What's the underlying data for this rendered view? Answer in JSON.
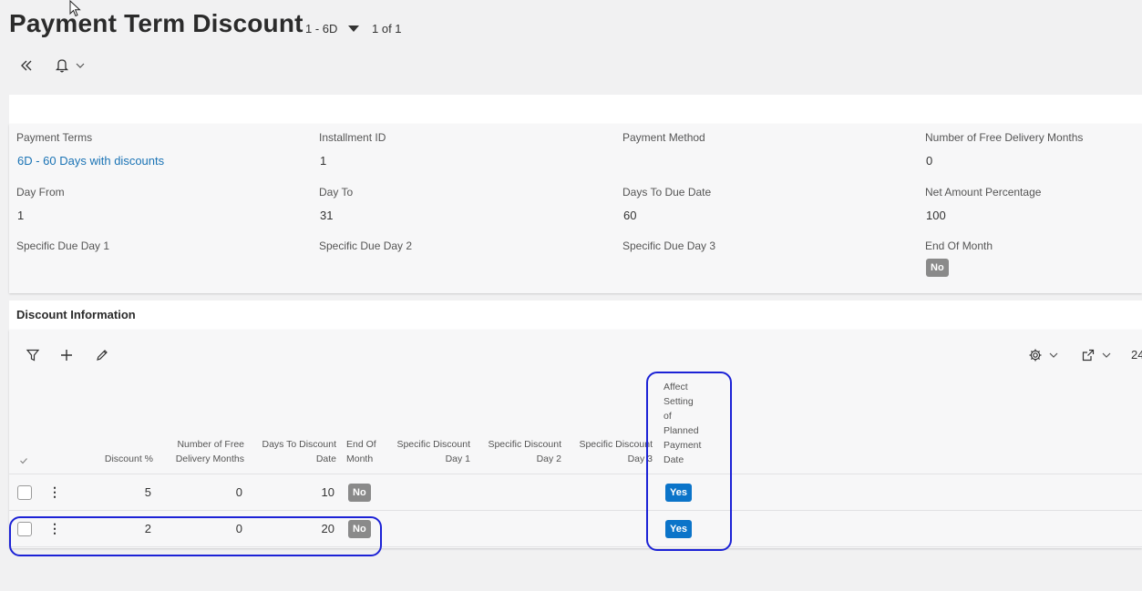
{
  "page": {
    "title": "Payment Term Discount",
    "record_selector": "1 - 6D",
    "record_count": "1 of 1"
  },
  "toolbar_icons": [
    "double-chevron-left-icon",
    "bell-icon",
    "chevron-down-icon"
  ],
  "fields": {
    "payment_terms": {
      "label": "Payment Terms",
      "value": "6D - 60 Days with discounts"
    },
    "installment_id": {
      "label": "Installment ID",
      "value": "1"
    },
    "payment_method": {
      "label": "Payment Method",
      "value": ""
    },
    "free_delivery_months": {
      "label": "Number of Free Delivery Months",
      "value": "0"
    },
    "day_from": {
      "label": "Day From",
      "value": "1"
    },
    "day_to": {
      "label": "Day To",
      "value": "31"
    },
    "days_to_due_date": {
      "label": "Days To Due Date",
      "value": "60"
    },
    "net_amount_pct": {
      "label": "Net Amount Percentage",
      "value": "100"
    },
    "specific_due_day_1": {
      "label": "Specific Due Day 1",
      "value": ""
    },
    "specific_due_day_2": {
      "label": "Specific Due Day 2",
      "value": ""
    },
    "specific_due_day_3": {
      "label": "Specific Due Day 3",
      "value": ""
    },
    "end_of_month": {
      "label": "End Of Month",
      "value": "No"
    }
  },
  "discount": {
    "title": "Discount Information",
    "page_size_partial": "24",
    "columns": {
      "discount_pct": "Discount %",
      "free_delivery_1": "Number of Free",
      "free_delivery_2": "Delivery Months",
      "days_to_discount_1": "Days To Discount",
      "days_to_discount_2": "Date",
      "end_of_month_1": "End Of",
      "end_of_month_2": "Month",
      "sdd1_1": "Specific Discount",
      "sdd1_2": "Day 1",
      "sdd2_1": "Specific Discount",
      "sdd2_2": "Day 2",
      "sdd3_1": "Specific Discount",
      "sdd3_2": "Day 3",
      "affect_1": "Affect",
      "affect_2": "Setting",
      "affect_3": "of",
      "affect_4": "Planned",
      "affect_5": "Payment",
      "affect_6": "Date"
    },
    "rows": [
      {
        "discount_pct": "5",
        "free_delivery_months": "0",
        "days_to_discount": "10",
        "end_of_month": "No",
        "affect_planned": "Yes"
      },
      {
        "discount_pct": "2",
        "free_delivery_months": "0",
        "days_to_discount": "20",
        "end_of_month": "No",
        "affect_planned": "Yes"
      }
    ]
  },
  "colors": {
    "link": "#1a73b5",
    "yes_badge": "#0b74c9",
    "no_badge": "#8a8a8a",
    "highlight": "#1c22d6"
  }
}
